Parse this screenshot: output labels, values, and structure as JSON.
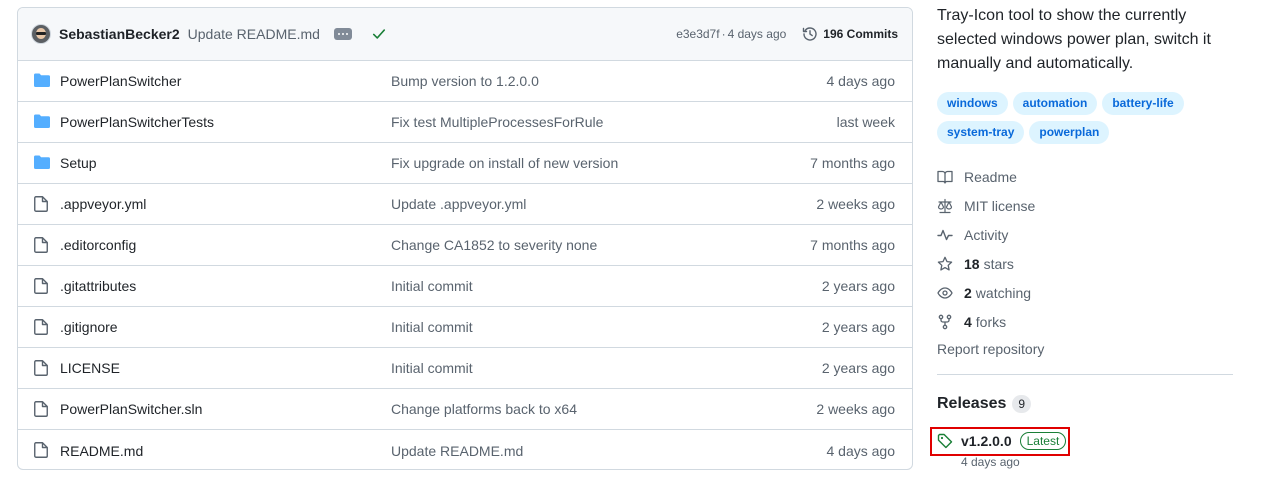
{
  "latest_commit": {
    "author": "SebastianBecker2",
    "message": "Update README.md",
    "hash": "e3e3d7f",
    "separator": "·",
    "age": "4 days ago",
    "commits_label": "196 Commits"
  },
  "files": [
    {
      "name": "PowerPlanSwitcher",
      "type": "folder",
      "commit": "Bump version to 1.2.0.0",
      "age": "4 days ago"
    },
    {
      "name": "PowerPlanSwitcherTests",
      "type": "folder",
      "commit": "Fix test MultipleProcessesForRule",
      "age": "last week"
    },
    {
      "name": "Setup",
      "type": "folder",
      "commit": "Fix upgrade on install of new version",
      "age": "7 months ago"
    },
    {
      "name": ".appveyor.yml",
      "type": "file",
      "commit": "Update .appveyor.yml",
      "age": "2 weeks ago"
    },
    {
      "name": ".editorconfig",
      "type": "file",
      "commit": "Change CA1852 to severity none",
      "age": "7 months ago"
    },
    {
      "name": ".gitattributes",
      "type": "file",
      "commit": "Initial commit",
      "age": "2 years ago"
    },
    {
      "name": ".gitignore",
      "type": "file",
      "commit": "Initial commit",
      "age": "2 years ago"
    },
    {
      "name": "LICENSE",
      "type": "file",
      "commit": "Initial commit",
      "age": "2 years ago"
    },
    {
      "name": "PowerPlanSwitcher.sln",
      "type": "file",
      "commit": "Change platforms back to x64",
      "age": "2 weeks ago"
    },
    {
      "name": "README.md",
      "type": "file",
      "commit": "Update README.md",
      "age": "4 days ago"
    }
  ],
  "sidebar": {
    "about": "Tray-Icon tool to show the currently selected windows power plan, switch it manually and automatically.",
    "topics": [
      "windows",
      "automation",
      "battery-life",
      "system-tray",
      "powerplan"
    ],
    "readme": "Readme",
    "license": "MIT license",
    "activity": "Activity",
    "stars_count": "18",
    "stars_label": "stars",
    "watching_count": "2",
    "watching_label": "watching",
    "forks_count": "4",
    "forks_label": "forks",
    "report": "Report repository"
  },
  "releases": {
    "title": "Releases",
    "count": "9",
    "latest_name": "v1.2.0.0",
    "latest_badge": "Latest",
    "latest_date": "4 days ago"
  },
  "colors": {
    "folder": "#54aeff",
    "link": "#0969da",
    "success": "#1a7f37",
    "highlight": "#e00000"
  }
}
